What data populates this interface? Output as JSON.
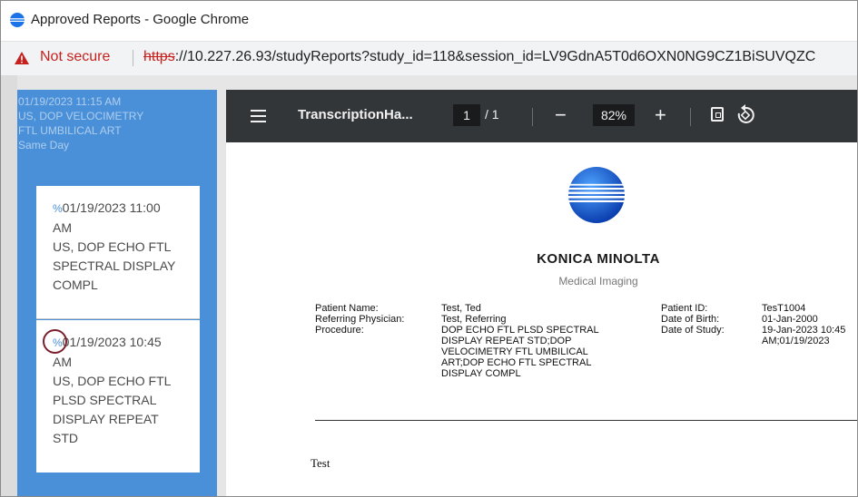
{
  "window": {
    "title": "Approved Reports - Google Chrome"
  },
  "address_bar": {
    "security_label": "Not secure",
    "url_scheme": "https",
    "url_rest": "://10.227.26.93/studyReports?study_id=118&session_id=LV9GdnA5T0d6OXN0NG9CZ1BiSUVQZC"
  },
  "study": {
    "datetime": "01/19/2023 11:15 AM",
    "procedure_line1": "US, DOP VELOCIMETRY",
    "procedure_line2": "FTL UMBILICAL ART",
    "status": "Same Day"
  },
  "reports": [
    {
      "datetime_1": "01/19/2023 11:00",
      "datetime_2": "AM",
      "line1": "US, DOP ECHO FTL",
      "line2": "SPECTRAL DISPLAY",
      "line3": "COMPL",
      "icon": "link-icon"
    },
    {
      "datetime_1": "01/19/2023 10:45",
      "datetime_2": "AM",
      "line1": "US, DOP ECHO FTL",
      "line2": "PLSD SPECTRAL",
      "line3": "DISPLAY REPEAT",
      "line4": "STD",
      "icon": "link-icon"
    }
  ],
  "pdf_viewer": {
    "file_title": "TranscriptionHa...",
    "page_current": "1",
    "page_total": "/ 1",
    "zoom": "82%",
    "zoom_out": "−",
    "zoom_in": "+"
  },
  "document": {
    "brand": "KONICA MINOLTA",
    "brand_sub": "Medical Imaging",
    "labels": [
      "Patient Name:",
      "Referring Physician:",
      "Procedure:"
    ],
    "values": [
      "Test, Ted",
      "Test, Referring",
      "DOP ECHO FTL PLSD SPECTRAL",
      "DISPLAY REPEAT STD;DOP",
      "VELOCIMETRY FTL UMBILICAL",
      "ART;DOP ECHO FTL SPECTRAL",
      "DISPLAY COMPL"
    ],
    "labels2": [
      "Patient ID:",
      "Date of Birth:",
      "Date of Study:"
    ],
    "values2": [
      "TesT1004",
      "01-Jan-2000",
      "19-Jan-2023 10:45",
      "AM;01/19/2023"
    ],
    "body": "Test"
  },
  "colors": {
    "panel_blue": "#4a90d9",
    "toolbar": "#323639",
    "not_secure_red": "#c5221f",
    "annotation": "#7a1f2b"
  }
}
